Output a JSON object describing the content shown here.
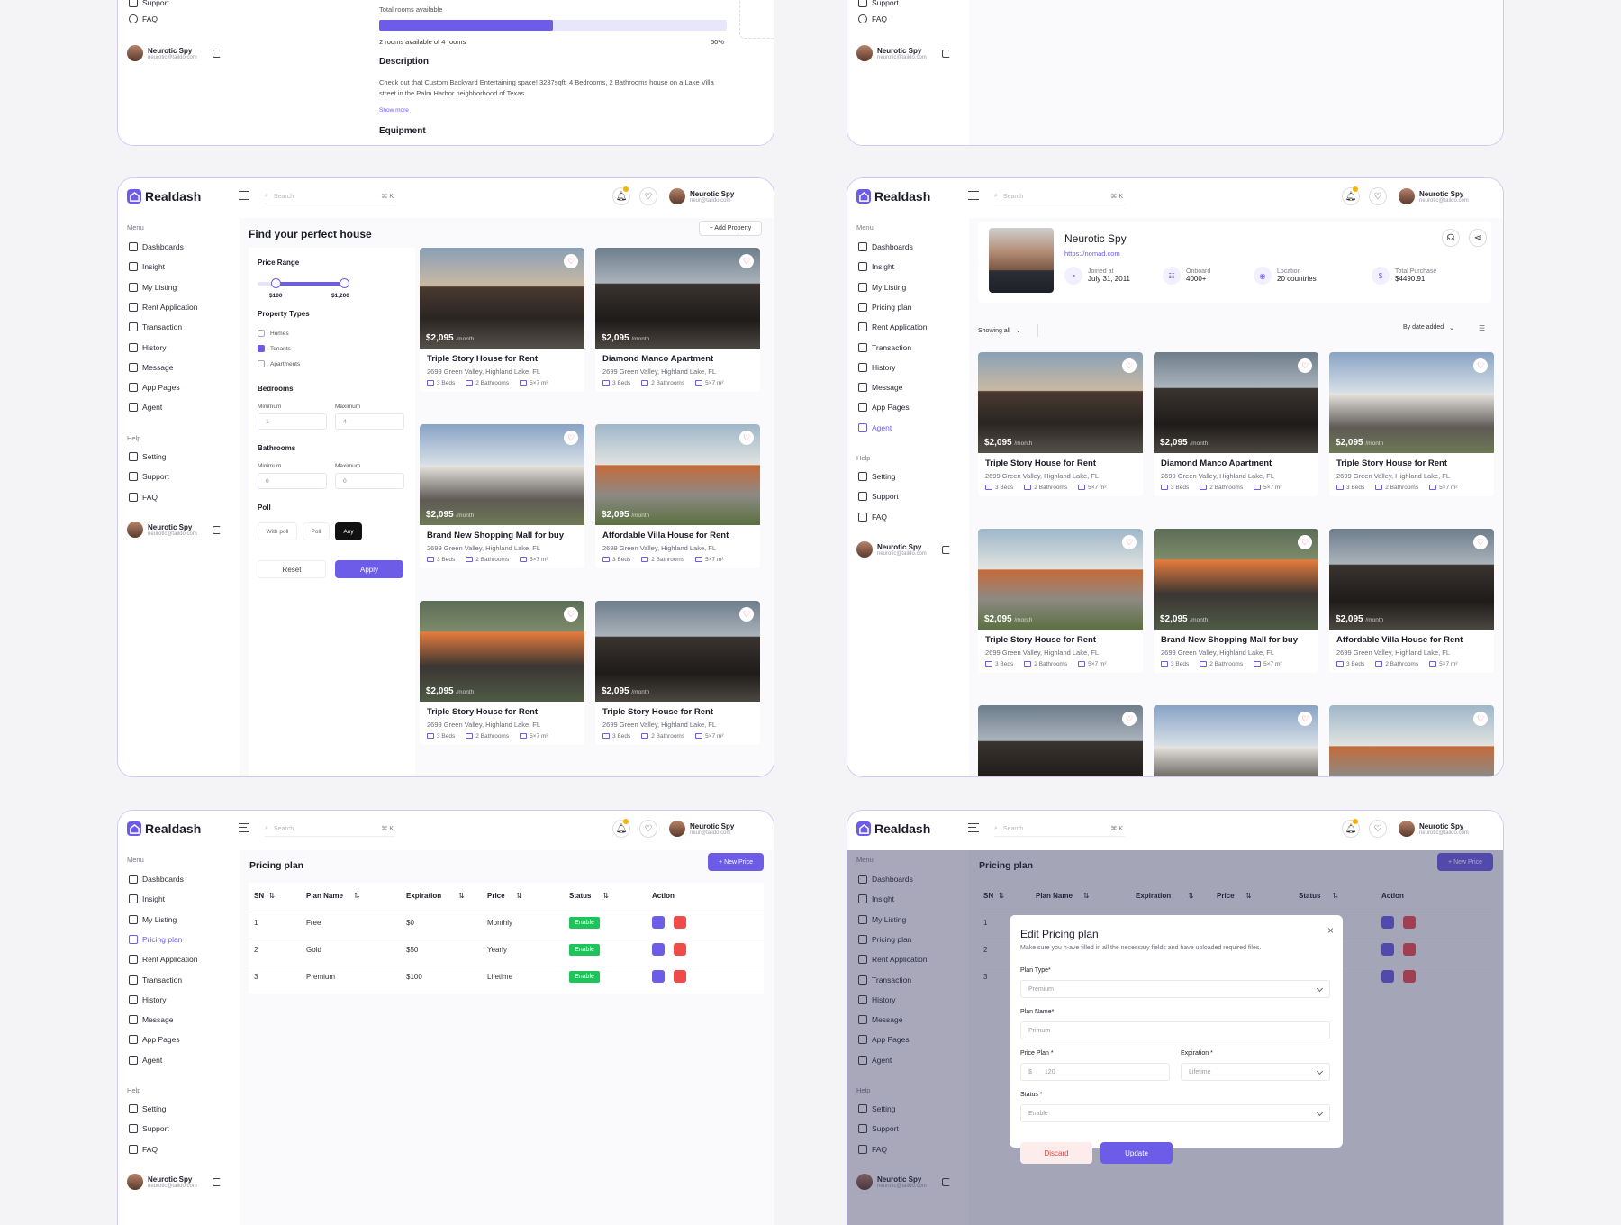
{
  "brand": "Realdash",
  "user": {
    "name": "Neurotic Spy",
    "email": "neurotic@taildo.com",
    "email_short": "neur@taildo.com"
  },
  "search": {
    "placeholder": "Search",
    "shortcut": "⌘ K"
  },
  "menu": {
    "menu_label": "Menu",
    "help_label": "Help",
    "items_a": [
      "Dashboards",
      "Insight",
      "My Listing",
      "Rent Application",
      "Transaction",
      "History",
      "Message",
      "App Pages",
      "Agent"
    ],
    "items_b": [
      "Dashboards",
      "Insight",
      "My Listing",
      "Pricing plan",
      "Rent Application",
      "Transaction",
      "History",
      "Message",
      "App Pages",
      "Agent"
    ],
    "help_items": [
      "Setting",
      "Support",
      "FAQ"
    ]
  },
  "top_left": {
    "rooms_label": "Total rooms available",
    "rooms_progress": 0.5,
    "rooms_text": "2 rooms available of 4 rooms",
    "rooms_pct": "50%",
    "desc_title": "Description",
    "desc_text": "Check out that Custom Backyard Entertaining space! 3237sqft, 4 Bedrooms, 2 Bathrooms house on a Lake Villa  street in the Palm Harbor neighborhood of Texas.",
    "show_more": "Show more",
    "equipment": "Equipment"
  },
  "find": {
    "title": "Find your perfect house",
    "add_property": "+ Add Property",
    "price_range": "Price Range",
    "range_min": "$100",
    "range_max": "$1,200",
    "range_min_frac": 0.2,
    "range_max_frac": 0.96,
    "property_types": "Property Types",
    "types": [
      {
        "label": "Homes",
        "checked": false
      },
      {
        "label": "Tenants",
        "checked": true
      },
      {
        "label": "Apartments",
        "checked": false
      }
    ],
    "bedrooms": "Bedrooms",
    "bathrooms": "Bathrooms",
    "minimum": "Minimum",
    "maximum": "Maximum",
    "bed_min": "1",
    "bed_max": "4",
    "bath_min": "0",
    "bath_max": "0",
    "poll": "Poll",
    "poll_options": [
      "With poll",
      "Poll",
      "Any"
    ],
    "reset": "Reset",
    "apply": "Apply"
  },
  "listing": {
    "price": "$2,095",
    "per": "/month",
    "address": "2699 Green Valley, Highland Lake, FL",
    "beds": "3 Beds",
    "baths": "2 Bathrooms",
    "area": "5×7 m²",
    "titles_a": [
      "Triple Story House for Rent",
      "Diamond Manco Apartment",
      "Brand New Shopping Mall for buy",
      "Affordable Villa House for Rent",
      "Triple Story House for Rent",
      "Triple Story House for Rent"
    ],
    "titles_b": [
      "Triple Story House for Rent",
      "Diamond Manco Apartment",
      "Triple Story House for Rent",
      "Triple Story House for Rent",
      "Brand New Shopping Mall for buy",
      "Affordable Villa House for Rent"
    ]
  },
  "profile": {
    "name": "Neurotic Spy",
    "url": "https://nomad.com",
    "joined_label": "Joined at",
    "joined": "July 31, 2011",
    "onboard_label": "Onboard",
    "onboard": "4000+",
    "location_label": "Location",
    "location": "20 countries",
    "purchase_label": "Total Purchase",
    "purchase": "$4490.91",
    "showing": "Showing all",
    "sort": "By date added"
  },
  "pricing": {
    "title": "Pricing plan",
    "new_price": "+ New Price",
    "headers": [
      "SN",
      "Plan Name",
      "Expiration",
      "Price",
      "Status",
      "Action"
    ],
    "rows": [
      {
        "sn": "1",
        "name": "Free",
        "exp": "$0",
        "price": "Monthly",
        "status": "Enable"
      },
      {
        "sn": "2",
        "name": "Gold",
        "exp": "$50",
        "price": "Yearly",
        "status": "Enable"
      },
      {
        "sn": "3",
        "name": "Premium",
        "exp": "$100",
        "price": "Lifetime",
        "status": "Enable"
      }
    ]
  },
  "modal": {
    "title": "Edit Pricing plan",
    "subtitle": "Make sure you h-ave filled in all the necessary fields and have uploaded required files.",
    "plan_type_label": "Plan Type*",
    "plan_type": "Premium",
    "plan_name_label": "Plan Name*",
    "plan_name": "Primum",
    "price_plan_label": "Price Plan *",
    "currency": "$",
    "price_value": "120",
    "expiration_label": "Expiration *",
    "expiration": "Lifetime",
    "status_label": "Status *",
    "status": "Enable",
    "discard": "Discard",
    "update": "Update",
    "close": "×"
  },
  "colors": {
    "accent": "#6c5ce7",
    "enable": "#1ec35a",
    "delete": "#f04b4b",
    "frame_border": "#cfcaf3"
  }
}
